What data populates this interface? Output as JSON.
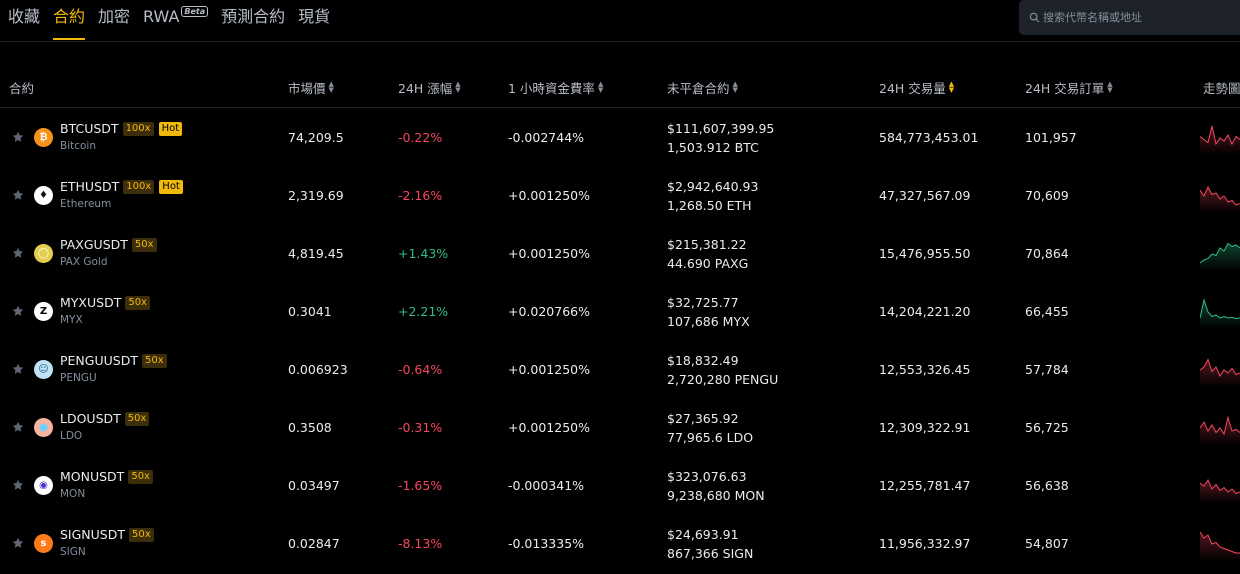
{
  "nav": {
    "tabs": [
      {
        "label": "收藏"
      },
      {
        "label": "合約",
        "active": true
      },
      {
        "label": "加密"
      },
      {
        "label": "RWA",
        "badge": "Beta"
      },
      {
        "label": "預測合約"
      },
      {
        "label": "現貨"
      }
    ],
    "search_placeholder": "搜索代幣名稱或地址"
  },
  "columns": {
    "contract": "合約",
    "price": "市場價",
    "change": "24H 漲幅",
    "funding": "1 小時資金費率",
    "open_interest": "未平倉合約",
    "volume": "24H 交易量",
    "orders": "24H 交易訂單",
    "trend": "走勢圖"
  },
  "colors": {
    "accent": "#f0b90b",
    "up": "#2ebd85",
    "down": "#f6465d"
  },
  "rows": [
    {
      "symbol": "BTCUSDT",
      "leverage": "100x",
      "hot": "Hot",
      "name": "Bitcoin",
      "icon": "bitcoin-icon",
      "price": "74,209.5",
      "change": "-0.22%",
      "dir": "down",
      "funding": "-0.002744%",
      "oi_usd": "$111,607,399.95",
      "oi_coin": "1,503.912 BTC",
      "volume": "584,773,453.01",
      "orders": "101,957",
      "spark": [
        0.55,
        0.45,
        0.35,
        0.9,
        0.3,
        0.5,
        0.4,
        0.6,
        0.3,
        0.55,
        0.45
      ]
    },
    {
      "symbol": "ETHUSDT",
      "leverage": "100x",
      "hot": "Hot",
      "name": "Ethereum",
      "icon": "ethereum-icon",
      "price": "2,319.69",
      "change": "-2.16%",
      "dir": "down",
      "funding": "+0.001250%",
      "oi_usd": "$2,942,640.93",
      "oi_coin": "1,268.50 ETH",
      "volume": "47,327,567.09",
      "orders": "70,609",
      "spark": [
        0.7,
        0.5,
        0.8,
        0.55,
        0.6,
        0.4,
        0.5,
        0.3,
        0.35,
        0.2,
        0.25
      ]
    },
    {
      "symbol": "PAXGUSDT",
      "leverage": "50x",
      "name": "PAX Gold",
      "icon": "pax-gold-icon",
      "price": "4,819.45",
      "change": "+1.43%",
      "dir": "up",
      "funding": "+0.001250%",
      "oi_usd": "$215,381.22",
      "oi_coin": "44.690 PAXG",
      "volume": "15,476,955.50",
      "orders": "70,864",
      "spark": [
        0.2,
        0.3,
        0.35,
        0.5,
        0.45,
        0.7,
        0.6,
        0.85,
        0.75,
        0.8,
        0.7
      ]
    },
    {
      "symbol": "MYXUSDT",
      "leverage": "50x",
      "name": "MYX",
      "icon": "myx-icon",
      "price": "0.3041",
      "change": "+2.21%",
      "dir": "up",
      "funding": "+0.020766%",
      "oi_usd": "$32,725.77",
      "oi_coin": "107,686 MYX",
      "volume": "14,204,221.20",
      "orders": "66,455",
      "spark": [
        0.3,
        0.9,
        0.5,
        0.35,
        0.4,
        0.3,
        0.35,
        0.3,
        0.32,
        0.28,
        0.3
      ]
    },
    {
      "symbol": "PENGUUSDT",
      "leverage": "50x",
      "name": "PENGU",
      "icon": "pengu-icon",
      "price": "0.006923",
      "change": "-0.64%",
      "dir": "down",
      "funding": "+0.001250%",
      "oi_usd": "$18,832.49",
      "oi_coin": "2,720,280 PENGU",
      "volume": "12,553,326.45",
      "orders": "57,784",
      "spark": [
        0.5,
        0.6,
        0.85,
        0.45,
        0.6,
        0.3,
        0.5,
        0.4,
        0.55,
        0.35,
        0.4
      ]
    },
    {
      "symbol": "LDOUSDT",
      "leverage": "50x",
      "name": "LDO",
      "icon": "ldo-icon",
      "price": "0.3508",
      "change": "-0.31%",
      "dir": "down",
      "funding": "+0.001250%",
      "oi_usd": "$27,365.92",
      "oi_coin": "77,965.6 LDO",
      "volume": "12,309,322.91",
      "orders": "56,725",
      "spark": [
        0.5,
        0.7,
        0.4,
        0.6,
        0.35,
        0.5,
        0.3,
        0.85,
        0.4,
        0.45,
        0.35
      ]
    },
    {
      "symbol": "MONUSDT",
      "leverage": "50x",
      "name": "MON",
      "icon": "monad-icon",
      "price": "0.03497",
      "change": "-1.65%",
      "dir": "down",
      "funding": "-0.000341%",
      "oi_usd": "$323,076.63",
      "oi_coin": "9,238,680 MON",
      "volume": "12,255,781.47",
      "orders": "56,638",
      "spark": [
        0.6,
        0.5,
        0.7,
        0.4,
        0.55,
        0.35,
        0.45,
        0.3,
        0.4,
        0.25,
        0.3
      ]
    },
    {
      "symbol": "SIGNUSDT",
      "leverage": "50x",
      "name": "SIGN",
      "icon": "sign-icon",
      "price": "0.02847",
      "change": "-8.13%",
      "dir": "down",
      "funding": "-0.013335%",
      "oi_usd": "$24,693.91",
      "oi_coin": "867,366 SIGN",
      "volume": "11,956,332.97",
      "orders": "54,807",
      "spark": [
        0.9,
        0.7,
        0.8,
        0.5,
        0.55,
        0.4,
        0.35,
        0.3,
        0.25,
        0.2,
        0.2
      ]
    }
  ]
}
